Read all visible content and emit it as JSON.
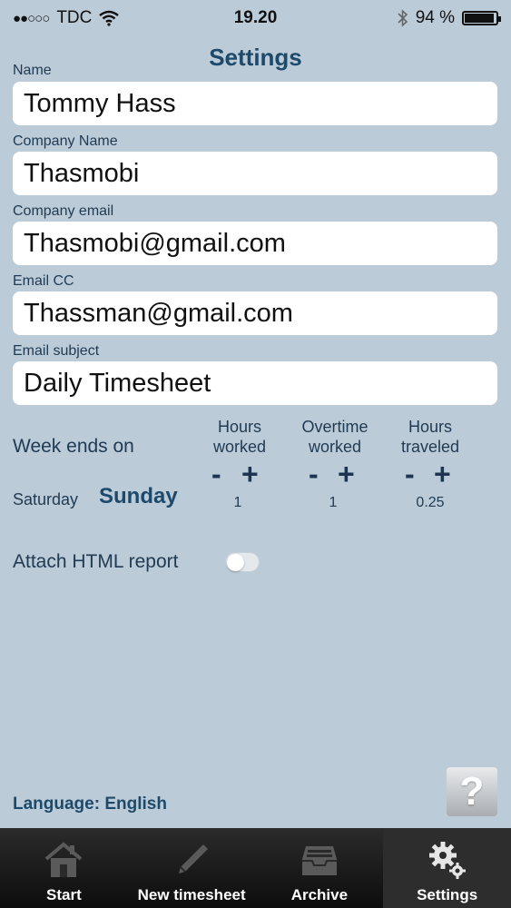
{
  "status_bar": {
    "carrier": "TDC",
    "signal": "●●○○○",
    "time": "19.20",
    "battery_percent": "94 %",
    "battery_level": 0.94
  },
  "title": "Settings",
  "fields": {
    "name": {
      "label": "Name",
      "value": "Tommy Hass"
    },
    "company_name": {
      "label": "Company Name",
      "value": "Thasmobi"
    },
    "company_email": {
      "label": "Company email",
      "value": "Thasmobi@gmail.com"
    },
    "email_cc": {
      "label": "Email CC",
      "value": "Thassman@gmail.com"
    },
    "email_subject": {
      "label": "Email subject",
      "value": "Daily Timesheet"
    }
  },
  "week": {
    "label": "Week ends on",
    "alt_day": "Saturday",
    "selected_day": "Sunday"
  },
  "counters": {
    "hours_worked": {
      "line1": "Hours",
      "line2": "worked",
      "value": "1"
    },
    "overtime_worked": {
      "line1": "Overtime",
      "line2": "worked",
      "value": "1"
    },
    "hours_traveled": {
      "line1": "Hours",
      "line2": "traveled",
      "value": "0.25"
    },
    "minus": "-",
    "plus": "+"
  },
  "attach_html": {
    "label": "Attach HTML report",
    "enabled": false
  },
  "language": "Language: English",
  "help_label": "?",
  "tabs": [
    {
      "label": "Start",
      "icon": "home-icon"
    },
    {
      "label": "New timesheet",
      "icon": "pencil-icon"
    },
    {
      "label": "Archive",
      "icon": "archive-tray-icon"
    },
    {
      "label": "Settings",
      "icon": "gears-icon",
      "active": true
    }
  ]
}
